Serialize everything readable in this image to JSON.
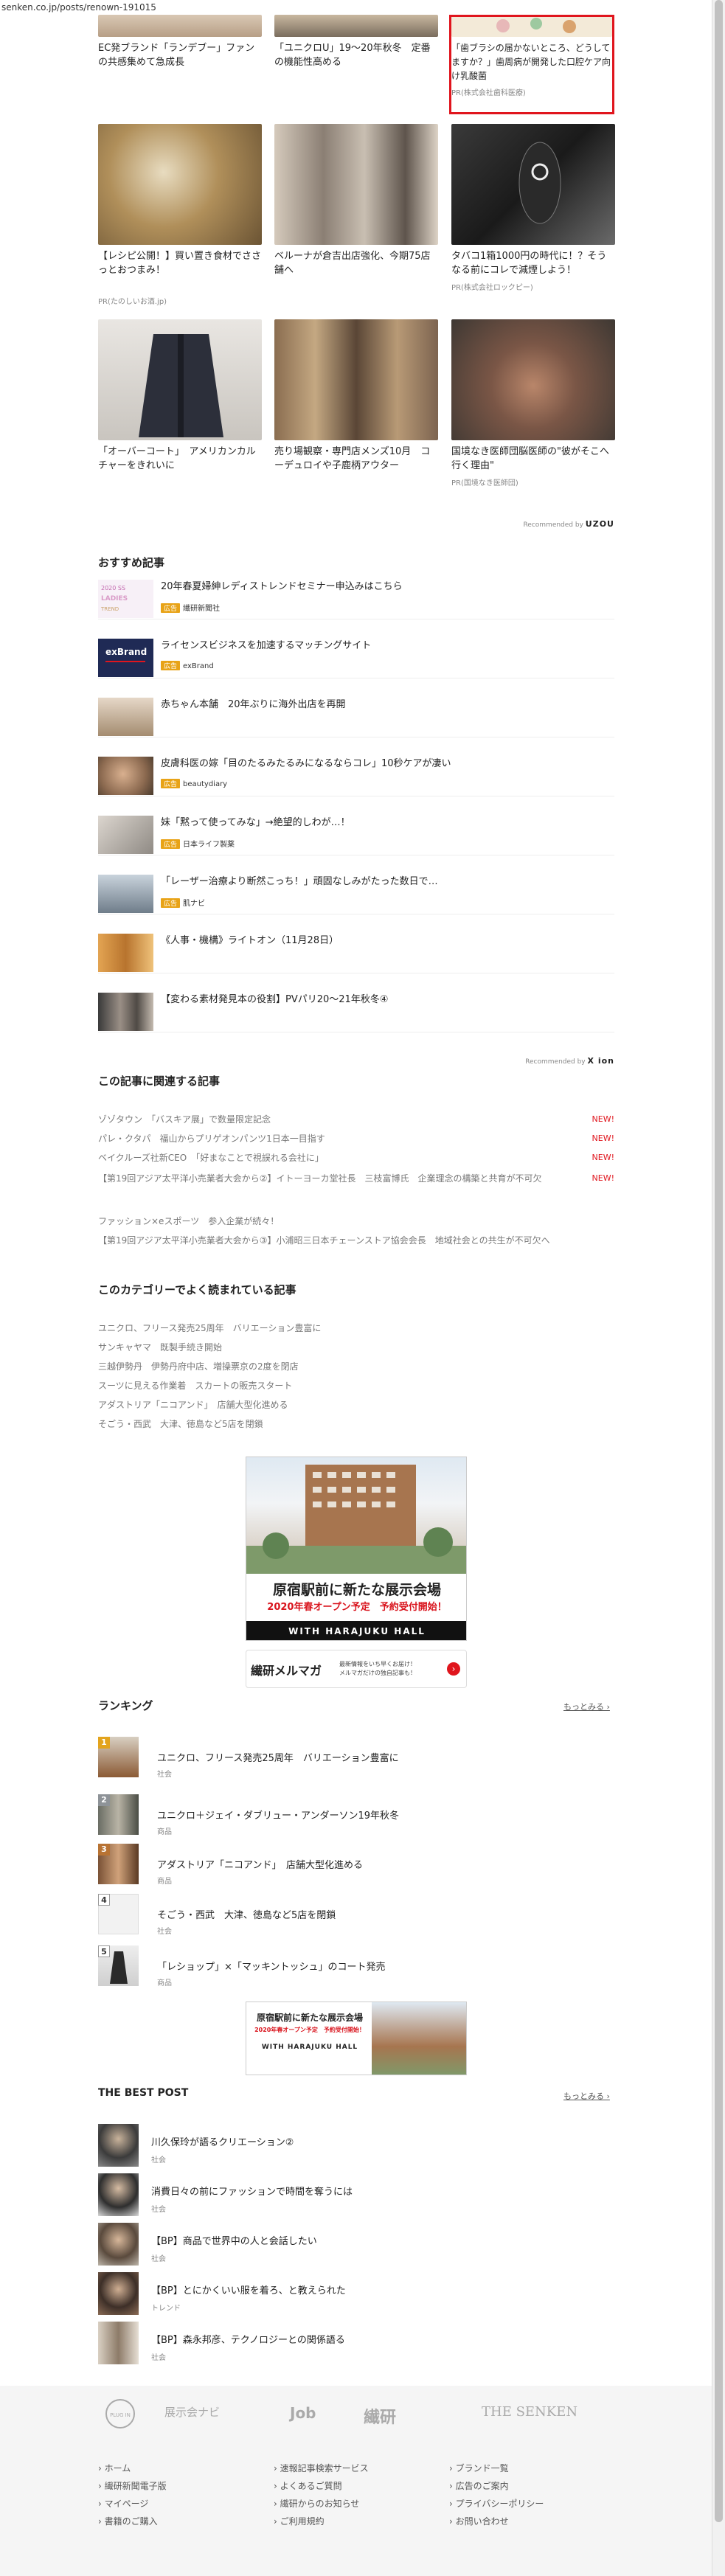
{
  "url": "senken.co.jp/posts/renown-191015",
  "reco_grid": {
    "row0": [
      {
        "title": "EC発ブランド「ランデブー」ファンの共感集めて急成長",
        "pr": ""
      },
      {
        "title": "「ユニクロU」19～20年秋冬　定番の機能性高める",
        "pr": ""
      },
      {
        "title": "「歯ブラシの届かないところ、どうしてますか？」歯周病が開発した口腔ケア向け乳酸菌",
        "pr": "PR(株式会社歯科医療)"
      }
    ],
    "row1": [
      {
        "title": "【レシピ公開！】買い置き食材でささっとおつまみ！",
        "pr": "PR(たのしいお酒.jp)"
      },
      {
        "title": "ベルーナが倉吉出店強化、今期75店舗へ",
        "pr": ""
      },
      {
        "title": "タバコ1箱1000円の時代に！？そうなる前にコレで減煙しよう！",
        "pr": "PR(株式会社ロックピー)"
      }
    ],
    "row2": [
      {
        "title": "「オーバーコート」　アメリカンカルチャーをきれいに",
        "pr": ""
      },
      {
        "title": "売り場観察・専門店メンズ10月　コーデュロイや子鹿柄アウター",
        "pr": ""
      },
      {
        "title": "国境なき医師団脳医師の\"彼がそこへ行く理由\"",
        "pr": "PR(国境なき医師団)"
      }
    ],
    "recommended_by": "Recommended by",
    "brand": "UZOU"
  },
  "osusume": {
    "heading": "おすすめ記事",
    "items": [
      {
        "title": "20年春夏婦紳レディストレンドセミナー申込みはこちら",
        "tag": "広告",
        "sponsor": "繊研新聞社"
      },
      {
        "title": "ライセンスビジネスを加速するマッチングサイト",
        "tag": "広告",
        "sponsor": "exBrand"
      },
      {
        "title": "赤ちゃん本舗　20年ぶりに海外出店を再開",
        "tag": "",
        "sponsor": ""
      },
      {
        "title": "皮膚科医の嫁「目のたるみたるみになるならコレ」10秒ケアが凄い",
        "tag": "広告",
        "sponsor": "beautydiary"
      },
      {
        "title": "妹「黙って使ってみな」→絶望的しわが…！",
        "tag": "広告",
        "sponsor": "日本ライフ製薬"
      },
      {
        "title": "「レーザー治療より断然こっち！」頑固なしみがたった数日で…",
        "tag": "広告",
        "sponsor": "肌ナビ"
      },
      {
        "title": "《人事・機構》ライトオン（11月28日）",
        "tag": "",
        "sponsor": ""
      },
      {
        "title": "【変わる素材発見本の役割】PVパリ20～21年秋冬④",
        "tag": "",
        "sponsor": ""
      }
    ],
    "recommended_by": "Recommended by",
    "brand": "X ion"
  },
  "related": {
    "heading": "この記事に関連する記事",
    "items": [
      {
        "text": "ゾゾタウン　「バスキア展」で数量限定記念",
        "new": "NEW!"
      },
      {
        "text": "パレ・クタパ　福山からプリゲオンパンツ1日本一目指す",
        "new": "NEW!"
      },
      {
        "text": "ベイクルーズ社新CEO　「好まなことで視誤れる会社に」",
        "new": "NEW!"
      },
      {
        "text": "【第19回アジア太平洋小売業者大会から②】イトーヨーカ堂社長　三枝富博氏　企業理念の構築と共育が不可欠",
        "new": "NEW!"
      },
      {
        "text": "ファッション×eスポーツ　参入企業が続々！",
        "new": ""
      },
      {
        "text": "【第19回アジア太平洋小売業者大会から③】小浦昭三日本チェーンストア協会会長　地域社会との共生が不可欠へ",
        "new": ""
      }
    ],
    "new_label": "NEW!"
  },
  "category": {
    "heading": "このカテゴリーでよく読まれている記事",
    "items": [
      "ユニクロ、フリース発売25周年　バリエーション豊富に",
      "サンキャヤマ　既製手続き開始",
      "三越伊勢丹　伊勢丹府中店、増操票京の2度を閉店",
      "スーツに見える作業着　スカートの販売スタート",
      "アダストリア「ニコアンド」　店舗大型化進める",
      "そごう・西武　大津、徳島など5店を閉鎖"
    ]
  },
  "banner1": {
    "headline": "原宿駅前に新たな展示会場",
    "sub": "2020年春オープン予定　予約受付開始！",
    "brand": "WITH HARAJUKU HALL"
  },
  "mailmag": {
    "title": "繊研メルマガ",
    "desc1": "最新情報をいち早くお届け！",
    "desc2": "メルマガだけの独自記事も！"
  },
  "ranking": {
    "heading": "ランキング",
    "more": "もっとみる ›",
    "items": [
      {
        "num": "1",
        "title": "ユニクロ、フリース発売25周年　バリエーション豊富に",
        "sub": "社会"
      },
      {
        "num": "2",
        "title": "ユニクロ＋ジェイ・ダブリュー・アンダーソン19年秋冬",
        "sub": "商品"
      },
      {
        "num": "3",
        "title": "アダストリア「ニコアンド」　店舗大型化進める",
        "sub": "商品"
      },
      {
        "num": "4",
        "title": "そごう・西武　大津、徳島など5店を閉鎖",
        "sub": "社会"
      },
      {
        "num": "5",
        "title": "「レショップ」×「マッキントッシュ」のコート発売",
        "sub": "商品"
      }
    ]
  },
  "banner2": {
    "headline": "原宿駅前に新たな展示会場",
    "sub": "2020年春オープン予定　予約受付開始！",
    "brand": "WITH HARAJUKU HALL"
  },
  "best_post": {
    "heading": "THE BEST POST",
    "more": "もっとみる ›",
    "items": [
      {
        "title": "川久保玲が語るクリエーション②",
        "sub": "社会"
      },
      {
        "title": "消費日々の前にファッションで時間を奪うには",
        "sub": "社会"
      },
      {
        "title": "【BP】商品で世界中の人と会話したい",
        "sub": "社会"
      },
      {
        "title": "【BP】とにかくいい服を着ろ、と教えられた",
        "sub": "トレンド"
      },
      {
        "title": "【BP】森永邦彦、テクノロジーとの関係語る",
        "sub": "社会"
      }
    ]
  },
  "footer": {
    "logos": [
      "PLUG IN",
      "展示会ナビ",
      "Job",
      "繊研",
      "THE SENKEN"
    ],
    "col1": [
      "› ホーム",
      "› 繊研新聞電子版",
      "› マイページ",
      "› 書籍のご購入"
    ],
    "col2": [
      "› 速報記事検索サービス",
      "› よくあるご質問",
      "› 繊研からのお知らせ",
      "› ご利用規約"
    ],
    "col3": [
      "› ブランド一覧",
      "› 広告のご案内",
      "› プライバシーポリシー",
      "› お問い合わせ"
    ]
  }
}
